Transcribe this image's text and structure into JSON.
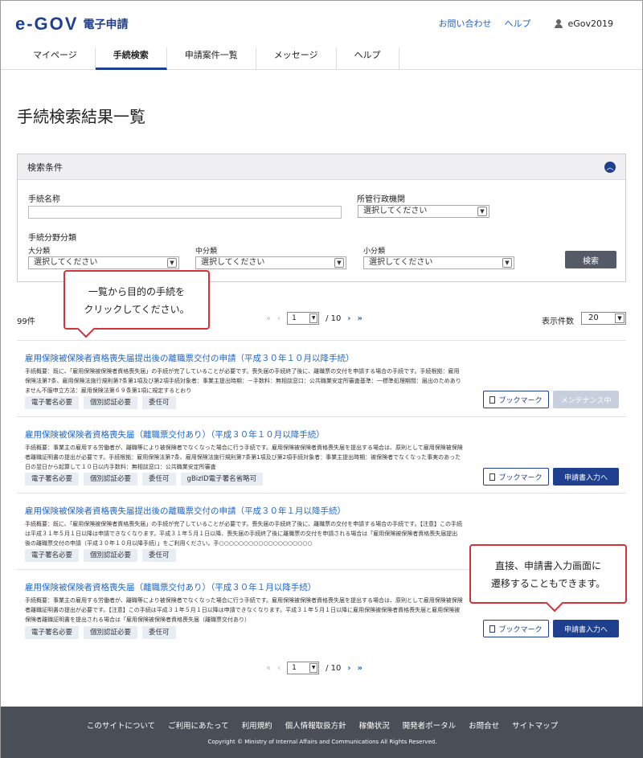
{
  "header": {
    "logo_mark": "e-GOV",
    "logo_text": "電子申請",
    "links": [
      "お問い合わせ",
      "ヘルプ"
    ],
    "user": "eGov2019"
  },
  "nav": [
    "マイページ",
    "手続検索",
    "申請案件一覧",
    "メッセージ",
    "ヘルプ"
  ],
  "page_title": "手続検索結果一覧",
  "search": {
    "head": "検索条件",
    "name_label": "手続名称",
    "agency_label": "所管行政機関",
    "agency_value": "選択してください",
    "category_label": "手続分野分類",
    "major_label": "大分類",
    "major_value": "選択してください",
    "mid_label": "中分類",
    "mid_value": "選択してください",
    "minor_label": "小分類",
    "minor_value": "選択してください",
    "search_button": "検索"
  },
  "callout1": [
    "一覧から目的の手続を",
    "クリックしてください。"
  ],
  "callout2": [
    "直接、申請書入力画面に",
    "遷移することもできます。"
  ],
  "results_count": "99件",
  "pager": {
    "current": "1",
    "total": "/ 10"
  },
  "per_page": {
    "label": "表示件数",
    "value": "20"
  },
  "results": [
    {
      "title": "雇用保険被保険者資格喪失届提出後の離職票交付の申請（平成３０年１０月以降手続）",
      "desc": "手続概要：既に、「雇用保険被保険者資格喪失届」の手続が完了していることが必要です。喪失届の手続終了後に、離職票の交付を申請する場合の手続です。手続根拠：雇用保険法第7条、雇用保険法施行規則第7条第1項及び第2項手続対象者：事業主提出時期：－手数料：無相談窓口：公共職業安定所審査基準：一標準処理期間：届出のためありません不服申立方法：雇用保険法第６９条第1項に規定するとおり",
      "tags": [
        "電子署名必要",
        "個別認証必要",
        "委任可"
      ],
      "bookmark": "ブックマーク",
      "action": "メンテナンス中"
    },
    {
      "title": "雇用保険被保険者資格喪失届（離職票交付あり）（平成３０年１０月以降手続）",
      "desc": "手続概要：事業主の雇用する労働者が、離職等により被保険者でなくなった場合に行う手続です。雇用保険被保険者資格喪失届を提出する場合は、原則として雇用保険被保険者離職証明書の提出が必要です。手続根拠：雇用保険法第7条、雇用保険法施行規則第7条第1項及び第2項手続対象者：事業主提出時期：被保険者でなくなった事実のあった日の翌日から起算して１０日以内手数料：無相談窓口：公共職業安定所審査",
      "tags": [
        "電子署名必要",
        "個別認証必要",
        "委任可",
        "gBizID電子署名省略可"
      ],
      "bookmark": "ブックマーク",
      "action": "申請書入力へ"
    },
    {
      "title": "雇用保険被保険者資格喪失届提出後の離職票交付の申請（平成３０年１月以降手続）",
      "desc": "手続概要：既に、「雇用保険被保険者資格喪失届」の手続が完了していることが必要です。喪失届の手続終了後に、離職票の交付を申請する場合の手続です。【注意】この手続は平成３１年５月１日以降は申請できなくなります。平成３１年５月１日以降、喪失届の手続終了後に離職票の交付を申請される場合は「雇用保険被保険者資格喪失届提出後の離職票交付の申請（平成３０年１０月以降手続）」をご利用ください。手○○○○○○○○○○○○○○○○○○○",
      "tags": [
        "電子署名必要",
        "個別認証必要",
        "委任可"
      ],
      "bookmark": "",
      "action": ""
    },
    {
      "title": "雇用保険被保険者資格喪失届（離職票交付あり）（平成３０年１月以降手続）",
      "desc": "手続概要：事業主の雇用する労働者が、離職等により被保険者でなくなった場合に行う手続です。雇用保険被保険者資格喪失届を提出する場合は、原則として雇用保険被保険者離職証明書の提出が必要です。【注意】この手続は平成３１年５月１日以降は申請できなくなります。平成３１年５月１日以降に雇用保険被保険者資格喪失届と雇用保険被保険者離職証明書を提出される場合は「雇用保険被保険者資格喪失届（離職票交付あり）",
      "tags": [
        "電子署名必要",
        "個別認証必要",
        "委任可"
      ],
      "bookmark": "ブックマーク",
      "action": "申請書入力へ"
    }
  ],
  "footer": {
    "links": [
      "このサイトについて",
      "ご利用にあたって",
      "利用規約",
      "個人情報取扱方針",
      "稼働状況",
      "開発者ポータル",
      "お問合せ",
      "サイトマップ"
    ],
    "copyright": "Copyright © Ministry of Internal Affairs and Communications All Rights Reserved."
  }
}
